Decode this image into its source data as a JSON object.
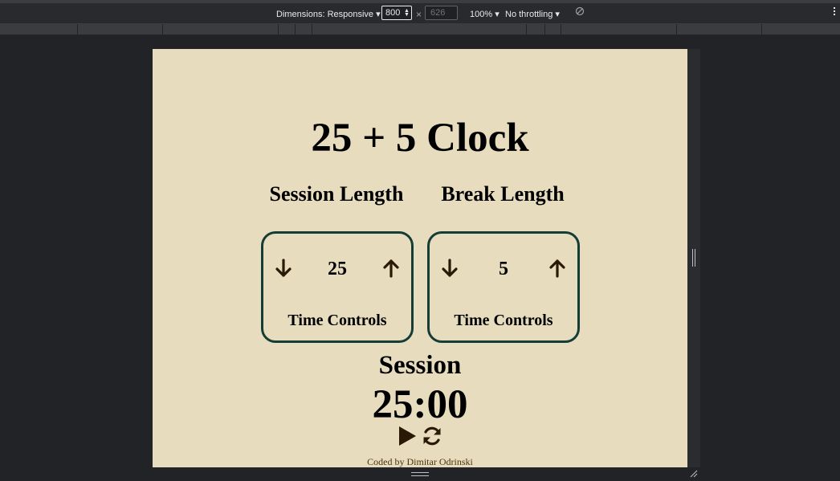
{
  "devtools": {
    "dimensions_label": "Dimensions: Responsive",
    "width_value": "800",
    "times_sign": "×",
    "height_placeholder": "626",
    "zoom_label": "100%",
    "throttling_label": "No throttling"
  },
  "app": {
    "title": "25 + 5 Clock",
    "session": {
      "label": "Session Length",
      "value": "25",
      "caption": "Time Controls"
    },
    "break": {
      "label": "Break Length",
      "value": "5",
      "caption": "Time Controls"
    },
    "timer_label": "Session",
    "time_left": "25:00",
    "footer": "Coded by Dimitar Odrinski"
  },
  "colors": {
    "background": "#e7dcbe",
    "box_border": "#153d36",
    "icon": "#2a1a05"
  },
  "icons": [
    "arrow-down-icon",
    "arrow-up-icon",
    "play-icon",
    "refresh-icon",
    "rotate-disabled-icon",
    "more-vert-icon"
  ]
}
